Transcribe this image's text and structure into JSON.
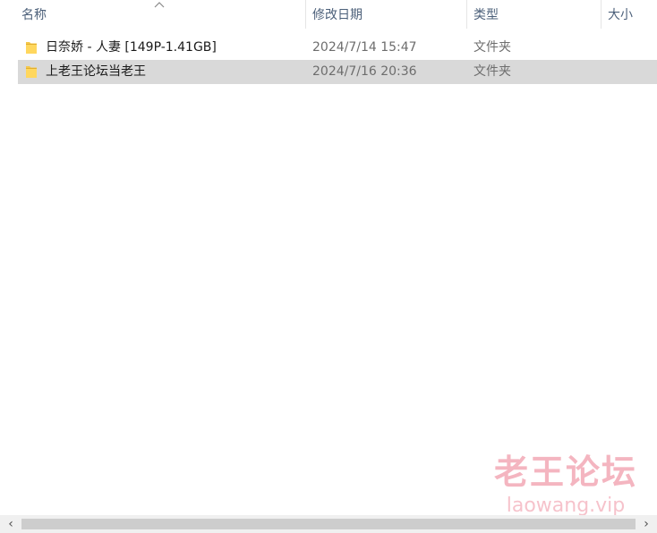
{
  "columns": {
    "name": "名称",
    "date": "修改日期",
    "type": "类型",
    "size": "大小"
  },
  "sort": {
    "column": "name",
    "direction": "ascending",
    "icon": "chevron-up-icon"
  },
  "files": [
    {
      "name": "日奈娇 - 人妻 [149P-1.41GB]",
      "modified": "2024/7/14 15:47",
      "type": "文件夹",
      "icon": "folder-icon",
      "selected": false
    },
    {
      "name": "上老王论坛当老王",
      "modified": "2024/7/16 20:36",
      "type": "文件夹",
      "icon": "folder-icon",
      "selected": true
    }
  ],
  "watermark": {
    "cn": "老王论坛",
    "en": "laowang.vip"
  },
  "scrollbar": {
    "left_icon": "chevron-left-icon",
    "right_icon": "chevron-right-icon"
  },
  "colors": {
    "folder": "#f5c84c",
    "selection": "#d9d9d9",
    "header_text": "#4c607a",
    "watermark": "#eb788c"
  }
}
